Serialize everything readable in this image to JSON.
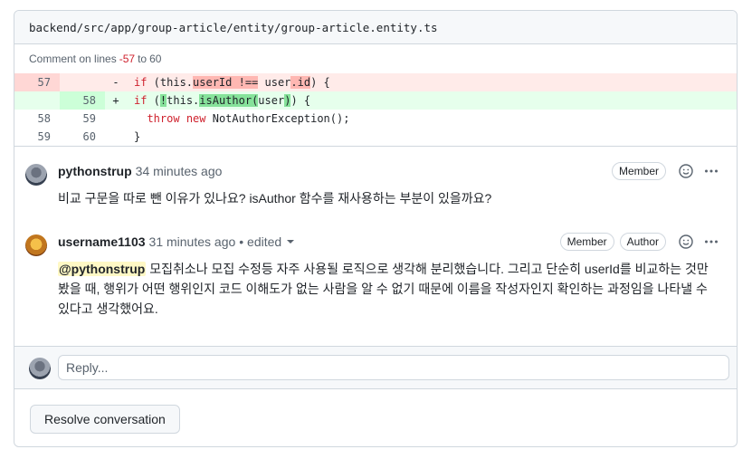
{
  "file": {
    "path": "backend/src/app/group-article/entity/group-article.entity.ts"
  },
  "comment_range": {
    "prefix": "Comment on lines",
    "start": "-57",
    "sep": "to",
    "end": "60"
  },
  "diff": {
    "rows": [
      {
        "type": "del",
        "old": "57",
        "new": "",
        "sign": "-"
      },
      {
        "type": "add",
        "old": "",
        "new": "58",
        "sign": "+"
      },
      {
        "type": "ctx",
        "old": "58",
        "new": "59",
        "sign": ""
      },
      {
        "type": "ctx",
        "old": "59",
        "new": "60",
        "sign": ""
      }
    ],
    "code": {
      "del": {
        "kw_if": "if",
        "a": " (this.",
        "hl1": "userId !==",
        "b": " user",
        "hl2": ".id",
        "c": ") {"
      },
      "add": {
        "kw_if": "if",
        "a": " (",
        "hl1": "!",
        "b": "this.",
        "hl2": "isAuthor(",
        "c": "user",
        "hl3": ")",
        "d": ") {"
      },
      "ctx1": {
        "kw_throw": "throw",
        "kw_new": "new",
        "rest": " NotAuthorException();"
      },
      "ctx2": {
        "rest": "}"
      }
    }
  },
  "comments": [
    {
      "author": "pythonstrup",
      "time": "34 minutes ago",
      "badges": [
        "Member"
      ],
      "body": "비교 구문을 따로 뺀 이유가 있나요? isAuthor 함수를 재사용하는 부분이 있을까요?"
    },
    {
      "author": "username1103",
      "time": "31 minutes ago",
      "edited": "• edited",
      "badges": [
        "Member",
        "Author"
      ],
      "mention": "@pythonstrup",
      "body": " 모집취소나 모집 수정등 자주 사용될 로직으로 생각해 분리했습니다. 그리고 단순히 userId를 비교하는 것만 봤을 때, 행위가 어떤 행위인지 코드 이해도가 없는 사람을 알 수 없기 때문에 이름을 작성자인지 확인하는 과정임을 나타낼 수 있다고 생각했어요."
    }
  ],
  "reply": {
    "placeholder": "Reply..."
  },
  "actions": {
    "resolve": "Resolve conversation"
  },
  "icons": {
    "smiley": "smiley-icon",
    "kebab": "kebab-horizontal-icon",
    "caret": "triangle-down-icon"
  }
}
